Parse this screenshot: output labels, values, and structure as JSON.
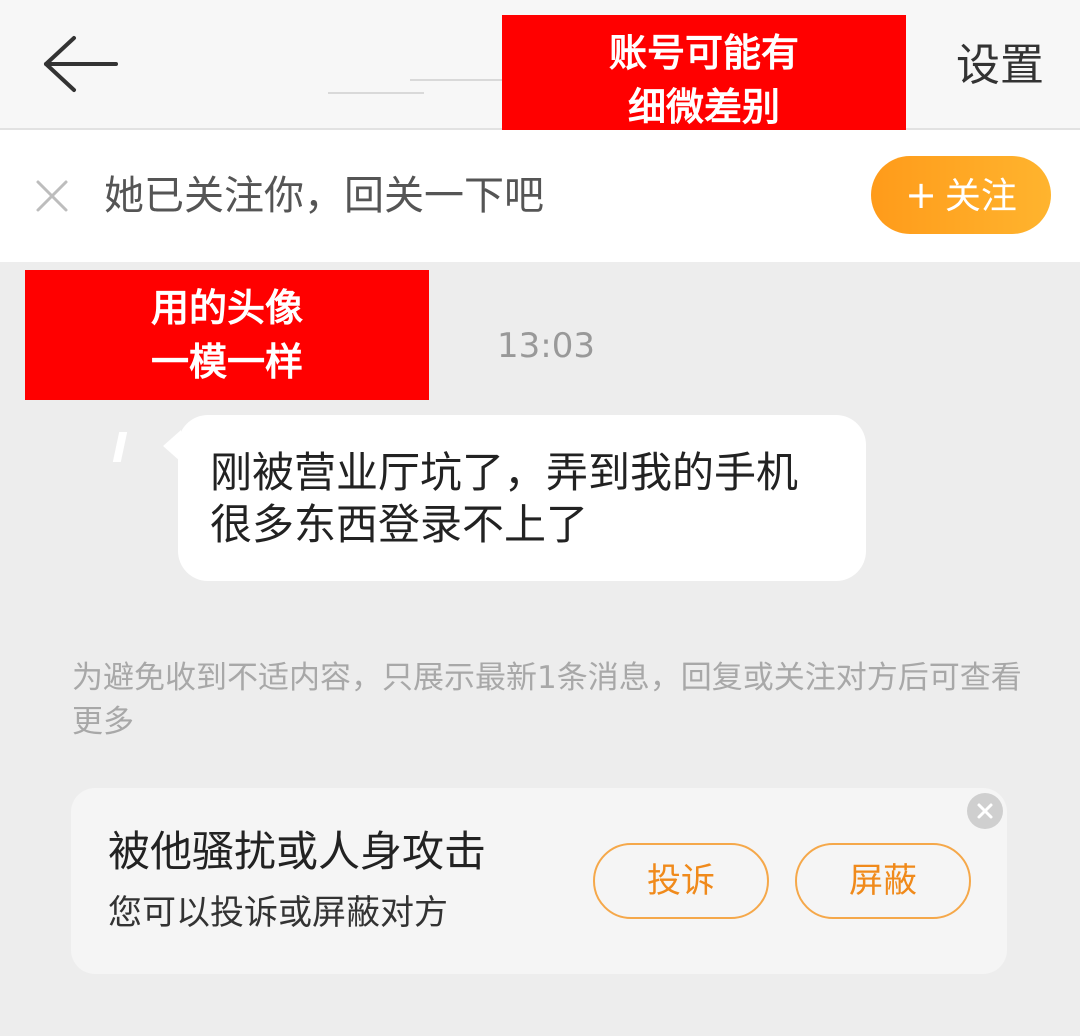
{
  "header": {
    "back_icon": "arrow-left-icon",
    "settings_label": "设置"
  },
  "annotations": {
    "top_label": [
      "账号可能有",
      "细微差别"
    ],
    "avatar_label": [
      "用的头像",
      "一模一样"
    ]
  },
  "follow_bar": {
    "close_icon": "close-icon",
    "text": "她已关注你，回关一下吧",
    "button_plus": "+",
    "button_label": "关注",
    "button_color": "#ffa724"
  },
  "chat": {
    "timestamp": "13:03",
    "message": "刚被营业厅坑了，弄到我的手机很多东西登录不上了",
    "notice": "为避免收到不适内容，只展示最新1条消息，回复或关注对方后可查看更多"
  },
  "report_card": {
    "title": "被他骚扰或人身攻击",
    "subtitle": "您可以投诉或屏蔽对方",
    "report_label": "投诉",
    "block_label": "屏蔽",
    "close_icon": "close-circle-icon",
    "accent_color": "#f08a1b"
  }
}
